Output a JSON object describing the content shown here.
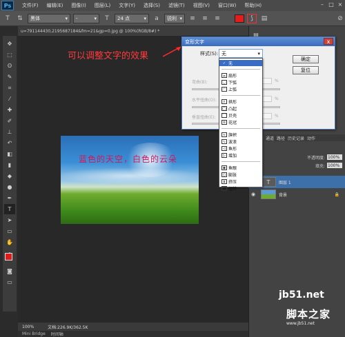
{
  "app": {
    "logo": "Ps"
  },
  "menu": [
    "文件(F)",
    "编辑(E)",
    "图像(I)",
    "图层(L)",
    "文字(Y)",
    "选择(S)",
    "滤镜(T)",
    "视图(V)",
    "窗口(W)",
    "帮助(H)"
  ],
  "options_bar": {
    "font_family": "黑体",
    "font_style": "-",
    "font_size": "24 点",
    "antialias": "锐利",
    "text_color": "#e51c1c"
  },
  "document_tab": "u=791144430,2195687184&fm=21&gp=0.jpg @ 100%(RGB/8#) *",
  "annotation": "可以调整文字的效果",
  "image_text": "蓝色的天空，白色的云朵",
  "status": {
    "zoom": "100%",
    "doc_size": "文档:226.9K/362.5K"
  },
  "bottom_tabs": [
    "Mini Bridge",
    "时间轴"
  ],
  "panel_tabs": [
    "通道",
    "路径",
    "历史记录",
    "动作"
  ],
  "layer_options": {
    "opacity_label": "不透明度:",
    "opacity_value": "100%",
    "fill_label": "填充:",
    "fill_value": "100%"
  },
  "layers": [
    {
      "name": "图层 1",
      "type": "text",
      "thumb_glyph": "T"
    },
    {
      "name": "背景",
      "type": "image"
    }
  ],
  "dialog": {
    "title": "变形文字",
    "close": "x",
    "style_label": "样式(S):",
    "style_value": "无",
    "ok": "确定",
    "cancel": "复位",
    "labels": [
      "弯曲(B):",
      "水平扭曲(O):",
      "垂直扭曲(E):"
    ],
    "pct": "%"
  },
  "dropdown": {
    "groups": [
      [
        {
          "label": "无",
          "glyph": "✓",
          "selected": true
        }
      ],
      [
        {
          "label": "扇形",
          "glyph": "⌓"
        },
        {
          "label": "下弧",
          "glyph": "◡"
        },
        {
          "label": "上弧",
          "glyph": "◠"
        }
      ],
      [
        {
          "label": "拱形",
          "glyph": "∩"
        },
        {
          "label": "凸起",
          "glyph": "◯"
        },
        {
          "label": "贝壳",
          "glyph": "⌒"
        },
        {
          "label": "花冠",
          "glyph": "♔"
        }
      ],
      [
        {
          "label": "旗帜",
          "glyph": "≈"
        },
        {
          "label": "波浪",
          "glyph": "∿"
        },
        {
          "label": "鱼形",
          "glyph": "◁"
        },
        {
          "label": "增加",
          "glyph": "▷"
        }
      ],
      [
        {
          "label": "鱼眼",
          "glyph": "◉"
        },
        {
          "label": "膨胀",
          "glyph": "○"
        },
        {
          "label": "挤压",
          "glyph": "⧖"
        },
        {
          "label": "扭转",
          "glyph": "↺"
        }
      ]
    ]
  },
  "watermark": {
    "site": "jb51.net",
    "brand": "脚本之家",
    "url": "www.jb51.net"
  }
}
